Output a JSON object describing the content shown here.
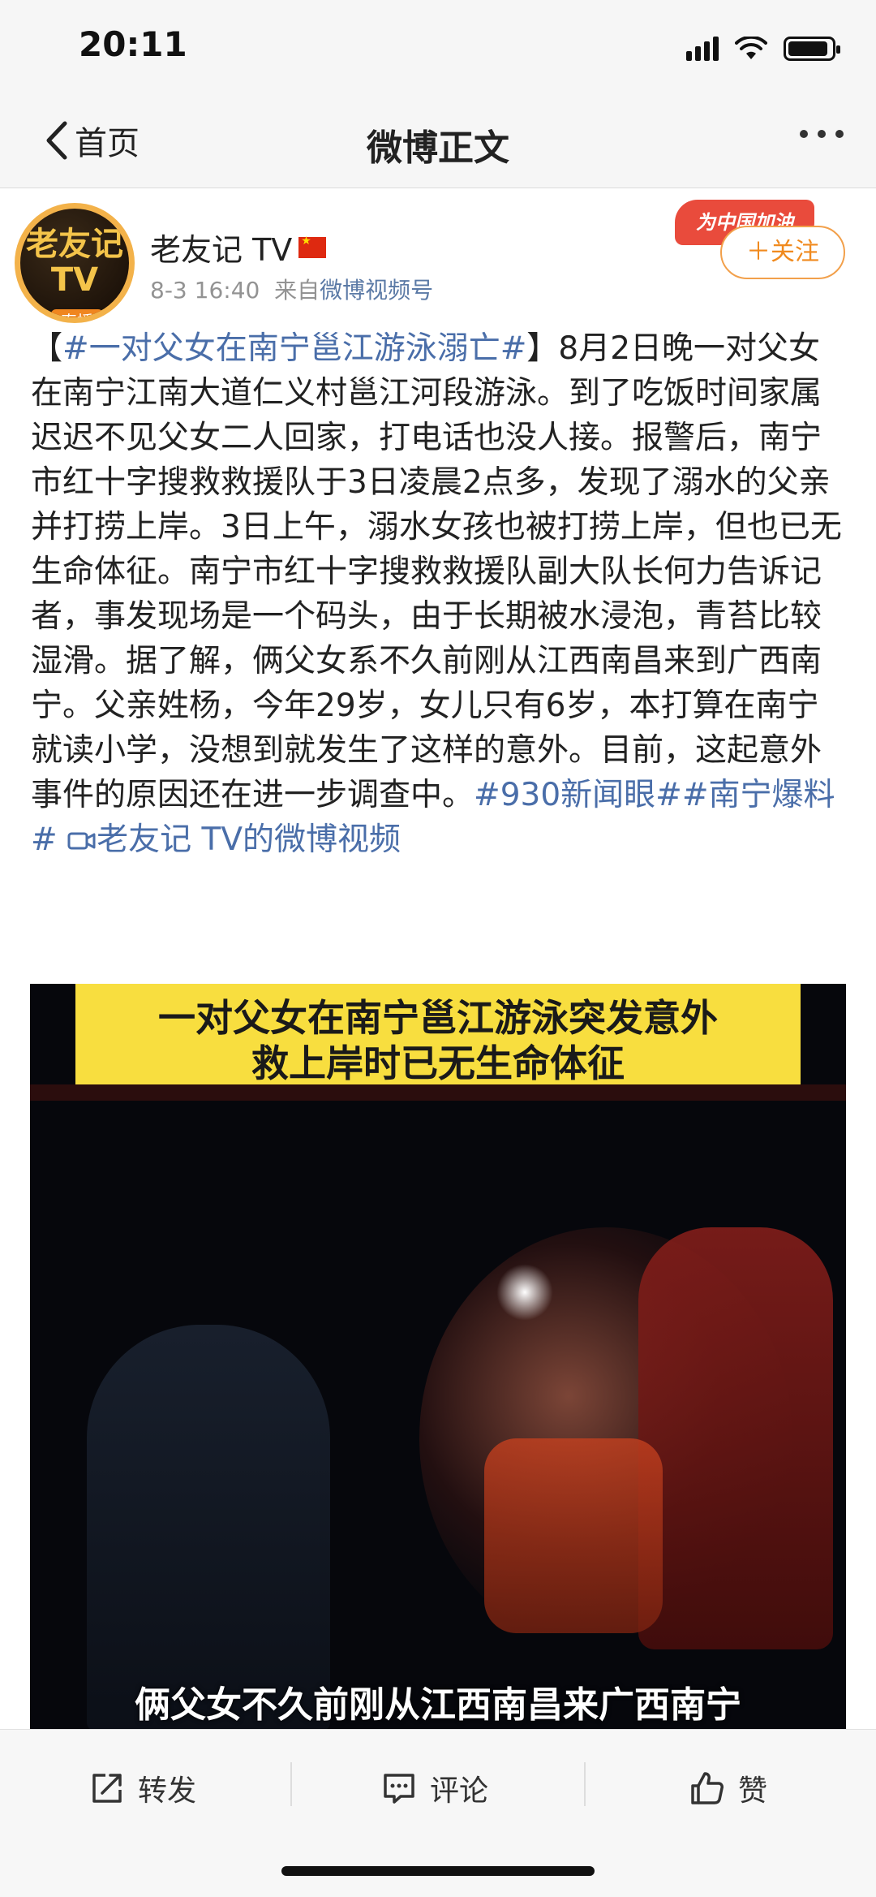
{
  "status_bar": {
    "time": "20:11"
  },
  "nav": {
    "back_label": "首页",
    "title": "微博正文"
  },
  "author": {
    "name": "老友记 TV",
    "avatar_text": "老友记TV",
    "avatar_badge": "直播",
    "time": "8-3 16:40",
    "source_prefix": "来自",
    "source": "微博视频号",
    "cheer_badge": "为中国加油",
    "follow_label": "＋关注"
  },
  "post": {
    "bracket_open": "【",
    "topic": "#一对父女在南宁邕江游泳溺亡#",
    "bracket_close": "】",
    "body": "8月2日晚一对父女在南宁江南大道仁义村邕江河段游泳。到了吃饭时间家属迟迟不见父女二人回家，打电话也没人接。报警后，南宁市红十字搜救救援队于3日凌晨2点多，发现了溺水的父亲并打捞上岸。3日上午，溺水女孩也被打捞上岸，但也已无生命体征。南宁市红十字搜救救援队副大队长何力告诉记者，事发现场是一个码头，由于长期被水浸泡，青苔比较湿滑。据了解，俩父女系不久前刚从江西南昌来到广西南宁。父亲姓杨，今年29岁，女儿只有6岁，本打算在南宁就读小学，没想到就发生了这样的意外。目前，这起意外事件的原因还在进一步调查中。",
    "tag1": "#930新闻眼#",
    "tag2": "#南宁爆料#",
    "video_link": "老友记 TV的微博视频"
  },
  "video": {
    "banner_line1": "一对父女在南宁邕江游泳突发意外",
    "banner_line2": "救上岸时已无生命体征",
    "subtitle": "俩父女不久前刚从江西南昌来广西南宁"
  },
  "actions": {
    "repost": "转发",
    "comment": "评论",
    "like": "赞"
  },
  "colors": {
    "link": "#4a6ea9",
    "follow": "#f08a1e",
    "banner": "#f8de3f"
  }
}
